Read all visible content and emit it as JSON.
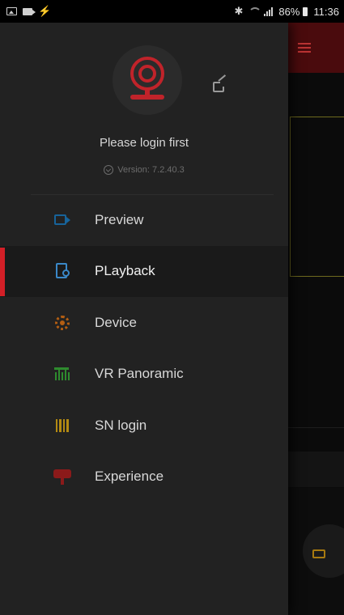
{
  "status_bar": {
    "battery": "86%",
    "time": "11:36",
    "left_icons": [
      "image-icon",
      "video-icon",
      "usb-icon"
    ],
    "right_icons": [
      "bluetooth-icon",
      "wifi-icon",
      "signal-icon",
      "battery-icon"
    ]
  },
  "drawer": {
    "login_text": "Please login first",
    "version": "Version: 7.2.40.3",
    "accent_color": "#d31f27",
    "menu": [
      {
        "label": "Preview",
        "icon": "video-camera-icon",
        "icon_color": "#17639a",
        "active": false
      },
      {
        "label": "PLayback",
        "icon": "playback-file-icon",
        "icon_color": "#3a88c8",
        "active": true
      },
      {
        "label": "Device",
        "icon": "gear-icon",
        "icon_color": "#b45e12",
        "active": false
      },
      {
        "label": "VR Panoramic",
        "icon": "vr-panorama-icon",
        "icon_color": "#2e8b2e",
        "active": false
      },
      {
        "label": "SN login",
        "icon": "barcode-icon",
        "icon_color": "#b38a12",
        "active": false
      },
      {
        "label": "Experience",
        "icon": "experience-sign-icon",
        "icon_color": "#8b1a1a",
        "active": false
      }
    ]
  }
}
